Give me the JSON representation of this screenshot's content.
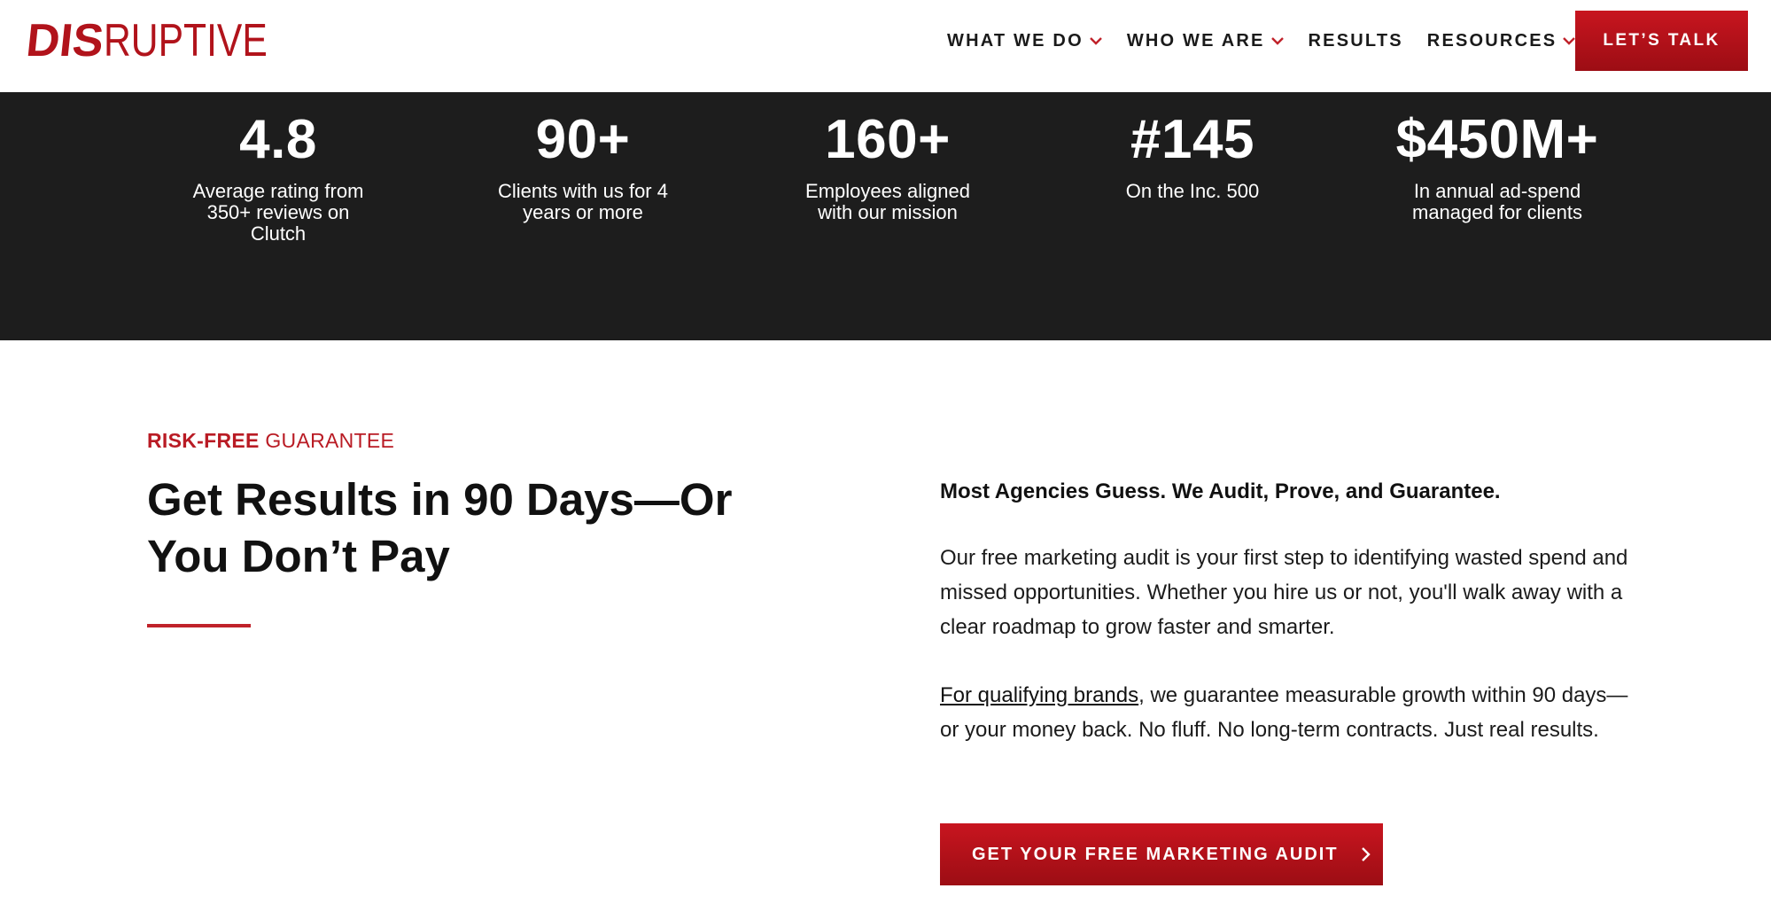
{
  "header": {
    "logo": {
      "part1": "DIS",
      "part2": "RUPTIVE"
    },
    "nav": [
      {
        "label": "WHAT WE DO",
        "has_dropdown": true
      },
      {
        "label": "WHO WE ARE",
        "has_dropdown": true
      },
      {
        "label": "RESULTS",
        "has_dropdown": false
      },
      {
        "label": "RESOURCES",
        "has_dropdown": true
      }
    ],
    "cta_label": "LET’S TALK"
  },
  "stats": [
    {
      "value": "4.8",
      "label": "Average rating from 350+ reviews on Clutch"
    },
    {
      "value": "90+",
      "label": "Clients with us for 4 years or more"
    },
    {
      "value": "160+",
      "label": "Employees aligned with our mission"
    },
    {
      "value": "#145",
      "label": "On the Inc. 500"
    },
    {
      "value": "$450M+",
      "label": "In annual ad-spend managed for clients"
    }
  ],
  "guarantee": {
    "eyebrow_bold": "RISK-FREE",
    "eyebrow_rest": " GUARANTEE",
    "headline": "Get Results in 90 Days—Or You Don’t Pay",
    "lead": "Most Agencies Guess. We Audit, Prove, and Guarantee.",
    "para1": "Our free marketing audit is your first step to identifying wasted spend and missed opportunities. Whether you hire us or not, you'll walk away with a clear roadmap to grow faster and smarter.",
    "para2_link": "For qualifying brands",
    "para2_rest": ", we guarantee measurable growth within 90 days—or your money back. No fluff. No long-term contracts. Just real results.",
    "button_label": "GET YOUR FREE MARKETING AUDIT"
  },
  "colors": {
    "brand_red": "#b1131b",
    "dark_band": "#1d1d1d"
  },
  "icons": {
    "dropdown": "chevron-down-icon",
    "button_arrow": "chevron-right-icon"
  }
}
